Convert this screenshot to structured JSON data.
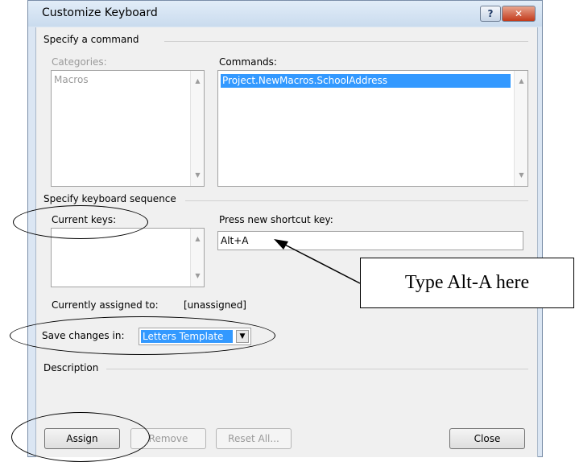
{
  "window": {
    "title": "Customize Keyboard",
    "help_glyph": "?",
    "close_glyph": "✕"
  },
  "specify_command": {
    "group_label": "Specify a command",
    "categories_label": "Categories:",
    "categories": [
      "Macros"
    ],
    "commands_label": "Commands:",
    "commands": [
      "Project.NewMacros.SchoolAddress"
    ]
  },
  "keyboard_sequence": {
    "group_label": "Specify keyboard sequence",
    "current_keys_label": "Current keys:",
    "press_new_label": "Press new shortcut key:",
    "press_new_value": "Alt+A",
    "assigned_label": "Currently assigned to:",
    "assigned_value": "[unassigned]"
  },
  "save_changes": {
    "label": "Save changes in:",
    "value": "Letters Template"
  },
  "description": {
    "group_label": "Description"
  },
  "buttons": {
    "assign": "Assign",
    "remove": "Remove",
    "reset_all": "Reset All...",
    "close": "Close"
  },
  "annotation": {
    "callout_text": "Type Alt-A here"
  },
  "icons": {
    "scroll_up": "▲",
    "scroll_down": "▼",
    "dropdown": "▼"
  }
}
